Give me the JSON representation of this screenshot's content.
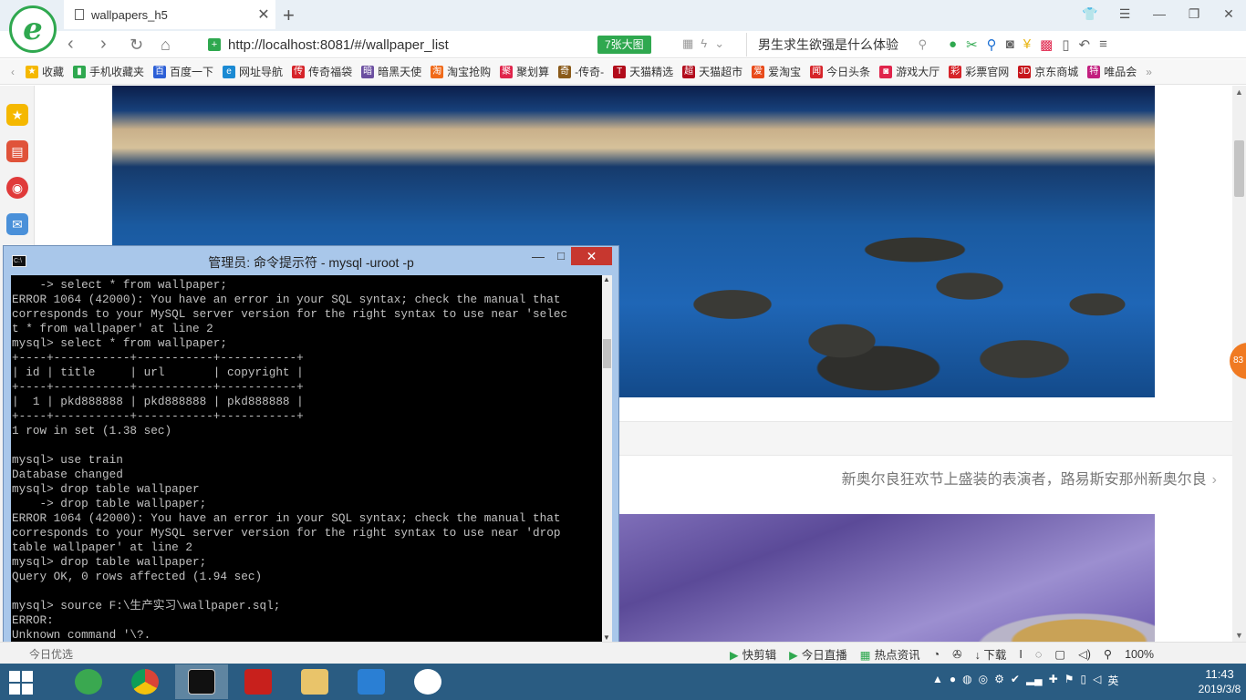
{
  "browser": {
    "tab_title": "wallpapers_h5",
    "url": "http://localhost:8081/#/wallpaper_list",
    "big_image_button": "7张大图",
    "search_query": "男生求生欲强是什么体验",
    "favorites": [
      {
        "label": "收藏",
        "icon": "star-icon",
        "color": "#f5b800"
      },
      {
        "label": "手机收藏夹",
        "icon": "phone-icon",
        "color": "#2fa84f"
      },
      {
        "label": "百度一下",
        "icon": "baidu-icon",
        "color": "#2c5fd6"
      },
      {
        "label": "网址导航",
        "icon": "ie-icon",
        "color": "#1b8ad3"
      },
      {
        "label": "传奇福袋",
        "icon": "game-icon",
        "color": "#d6242a"
      },
      {
        "label": "暗黑天使",
        "icon": "game-icon",
        "color": "#6b4fa0"
      },
      {
        "label": "淘宝抢购",
        "icon": "taobao-icon",
        "color": "#f06a1a"
      },
      {
        "label": "聚划算",
        "icon": "juhuasuan-icon",
        "color": "#e0244b"
      },
      {
        "label": "-传奇-",
        "icon": "game-icon",
        "color": "#8a5a1a"
      },
      {
        "label": "天猫精选",
        "icon": "tmall-icon",
        "color": "#b20c1c"
      },
      {
        "label": "天猫超市",
        "icon": "tmall-icon",
        "color": "#b20c1c"
      },
      {
        "label": "爱淘宝",
        "icon": "aitaobao-icon",
        "color": "#e84a1a"
      },
      {
        "label": "今日头条",
        "icon": "toutiao-icon",
        "color": "#d6242a"
      },
      {
        "label": "游戏大厅",
        "icon": "gamepad-icon",
        "color": "#e0244b"
      },
      {
        "label": "彩票官网",
        "icon": "lottery-icon",
        "color": "#d6242a"
      },
      {
        "label": "京东商城",
        "icon": "jd-icon",
        "color": "#c7161c"
      },
      {
        "label": "唯品会",
        "icon": "vip-icon",
        "color": "#c21e7e"
      }
    ]
  },
  "page": {
    "wallpaper_caption": "新奥尔良狂欢节上盛装的表演者，路易斯安那州新奥尔良"
  },
  "badge_text": "83",
  "cmd": {
    "title": "管理员: 命令提示符 - mysql  -uroot -p",
    "lines": [
      "    -> select * from wallpaper;",
      "ERROR 1064 (42000): You have an error in your SQL syntax; check the manual that",
      "corresponds to your MySQL server version for the right syntax to use near 'selec",
      "t * from wallpaper' at line 2",
      "mysql> select * from wallpaper;",
      "+----+-----------+-----------+-----------+",
      "| id | title     | url       | copyright |",
      "+----+-----------+-----------+-----------+",
      "|  1 | pkd888888 | pkd888888 | pkd888888 |",
      "+----+-----------+-----------+-----------+",
      "1 row in set (1.38 sec)",
      "",
      "mysql> use train",
      "Database changed",
      "mysql> drop table wallpaper",
      "    -> drop table wallpaper;",
      "ERROR 1064 (42000): You have an error in your SQL syntax; check the manual that",
      "corresponds to your MySQL server version for the right syntax to use near 'drop",
      "table wallpaper' at line 2",
      "mysql> drop table wallpaper;",
      "Query OK, 0 rows affected (1.94 sec)",
      "",
      "mysql> source F:\\生产实习\\wallpaper.sql;",
      "ERROR:",
      "Unknown command '\\?."
    ]
  },
  "statusbar": {
    "left_text": "今日优选",
    "items": [
      "快剪辑",
      "今日直播",
      "热点资讯",
      "下载"
    ],
    "zoom": "100%"
  },
  "taskbar": {
    "time": "11:43",
    "date": "2019/3/8",
    "ime": "英",
    "apps": [
      {
        "name": "360-browser-taskbar",
        "color": "#3aa850"
      },
      {
        "name": "chrome-taskbar",
        "color": "#e8b512"
      },
      {
        "name": "cmd-taskbar",
        "color": "#111111"
      },
      {
        "name": "pdf-taskbar",
        "color": "#c8201c"
      },
      {
        "name": "explorer-taskbar",
        "color": "#e9c46a"
      },
      {
        "name": "vscode-taskbar",
        "color": "#2a7fd4"
      },
      {
        "name": "anniversary-taskbar",
        "color": "#ffffff"
      }
    ]
  }
}
